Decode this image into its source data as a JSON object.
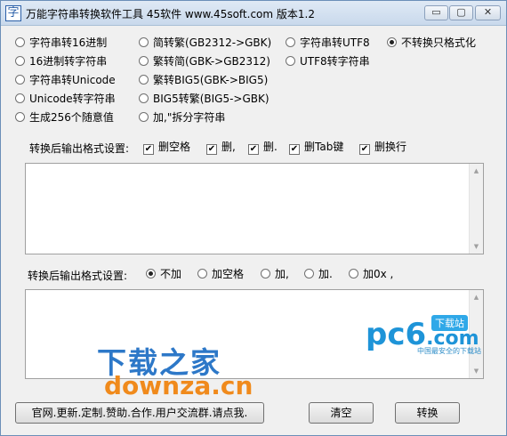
{
  "window": {
    "icon": "字",
    "title": "万能字符串转换软件工具 45软件 www.45soft.com 版本1.2",
    "minimize": "▭",
    "maximize": "▢",
    "close": "✕"
  },
  "modes": {
    "col1": [
      "字符串转16进制",
      "16进制转字符串",
      "字符串转Unicode",
      "Unicode转字符串",
      "生成256个随意值"
    ],
    "col2": [
      "简转繁(GB2312->GBK)",
      "繁转简(GBK->GB2312)",
      "繁转BIG5(GBK->BIG5)",
      "BIG5转繁(BIG5->GBK)",
      "加,\"拆分字符串"
    ],
    "col3": [
      "字符串转UTF8",
      "UTF8转字符串"
    ],
    "col4": [
      "不转换只格式化"
    ],
    "selected": "不转换只格式化"
  },
  "format1": {
    "label": "转换后输出格式设置:",
    "options": [
      "删空格",
      "删,",
      "删.",
      "删Tab键",
      "删换行"
    ]
  },
  "format2": {
    "label": "转换后输出格式设置:",
    "options": [
      "不加",
      "加空格",
      "加,",
      "加.",
      "加0x ,"
    ],
    "selected": "不加"
  },
  "buttons": {
    "website": "官网.更新.定制.赞助.合作.用户交流群.请点我.",
    "clear": "清空",
    "convert": "转换"
  },
  "watermark": {
    "pc6": "pc6",
    "pc6_tag": "下载站",
    "pc6_domain": ".com",
    "pc6_slogan": "中国最安全的下载站",
    "downza_cn": "下载之家",
    "downza_en": "downza.cn"
  }
}
